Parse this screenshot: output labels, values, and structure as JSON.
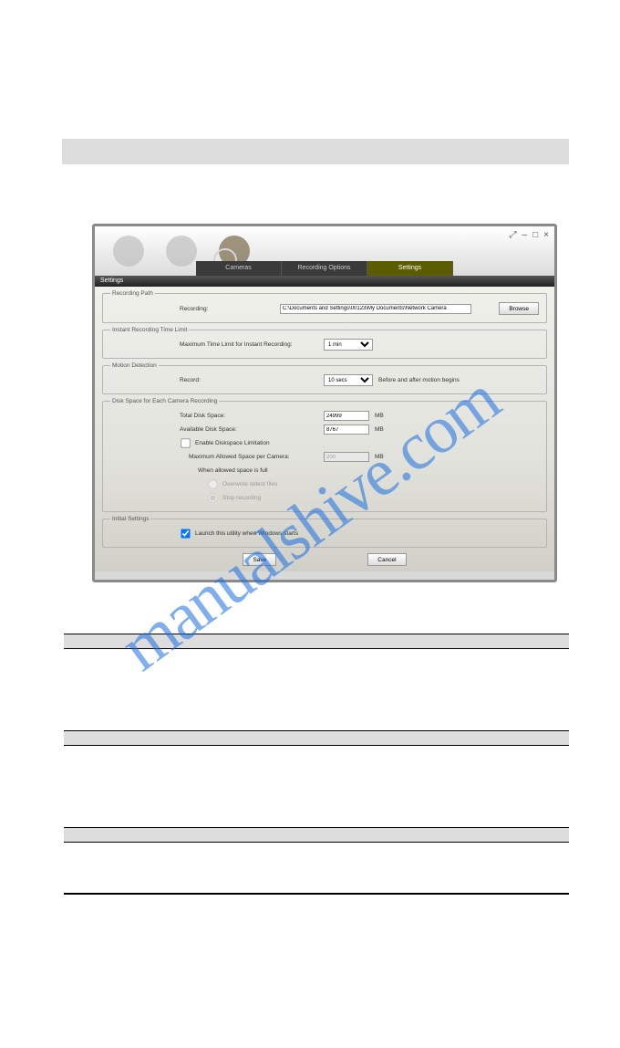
{
  "top_bar": "",
  "window": {
    "controls": {
      "expand": "⤢",
      "min": "–",
      "max": "□",
      "close": "×"
    },
    "tabs": {
      "cameras": "Cameras",
      "recording_options": "Recording Options",
      "settings": "Settings"
    },
    "panel_title": "Settings",
    "sections": {
      "recording_path": {
        "legend": "Recording Path",
        "label": "Recording:",
        "value": "C:\\Documents and Settings\\00123\\My Documents\\Network Camera",
        "browse": "Browse"
      },
      "instant": {
        "legend": "Instant Recording Time Limit",
        "label": "Maximum Time Limit for Instant Recording:",
        "value": "1 min"
      },
      "motion": {
        "legend": "Motion Detection",
        "label": "Record:",
        "value": "10 secs",
        "note": "Before and after motion begins"
      },
      "disk": {
        "legend": "Disk Space for Each Camera Recording",
        "total_label": "Total Disk Space:",
        "total_value": "24999",
        "avail_label": "Available Disk Space:",
        "avail_value": "8767",
        "unit": "MB",
        "enable_label": "Enable Diskspace Limitation",
        "max_label": "Maximum Allowed Space per Camera:",
        "max_value": "200",
        "when_label": "When allowed space is full",
        "opt1": "Overwrite oldest files",
        "opt2": "Stop recording"
      },
      "initial": {
        "legend": "Initial Settings",
        "launch_label": "Launch this utility when Windows starts"
      }
    },
    "buttons": {
      "save": "Save",
      "cancel": "Cancel"
    }
  },
  "watermark": "manualshive.com",
  "table": {
    "h1": "",
    "h2": "",
    "r1c1": "",
    "r1c2": "",
    "r2c1": "",
    "r2c2": "",
    "r3c1": "",
    "r3c2": ""
  }
}
